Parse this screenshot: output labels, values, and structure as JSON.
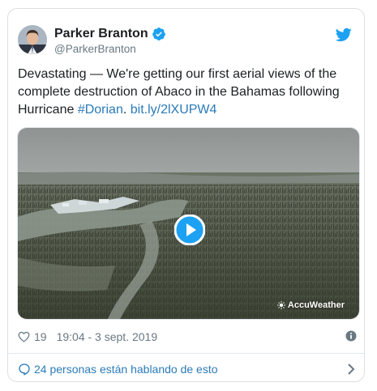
{
  "tweet": {
    "author_name": "Parker Branton",
    "author_handle": "@ParkerBranton",
    "text_before": "Devastating — We're getting our first aerial views of the complete destruction of Abaco in the Bahamas following Hurricane ",
    "hashtag": "#Dorian",
    "text_between": ". ",
    "short_link": "bit.ly/2lXUPW4",
    "media_watermark": "AccuWeather",
    "like_count": "19",
    "timestamp": "19:04 - 3 sept. 2019",
    "conversation_text": "24 personas están hablando de esto"
  },
  "icons": {
    "verified": "verified-badge-icon",
    "brand": "twitter-bird-icon",
    "like": "heart-icon",
    "info": "info-icon",
    "conversation": "speech-bubble-icon",
    "play": "play-icon",
    "more": "chevron-right-icon"
  },
  "colors": {
    "link": "#2b7bb9",
    "brand": "#1da1f2",
    "secondary_text": "#697882",
    "border": "#dcdfe2"
  }
}
